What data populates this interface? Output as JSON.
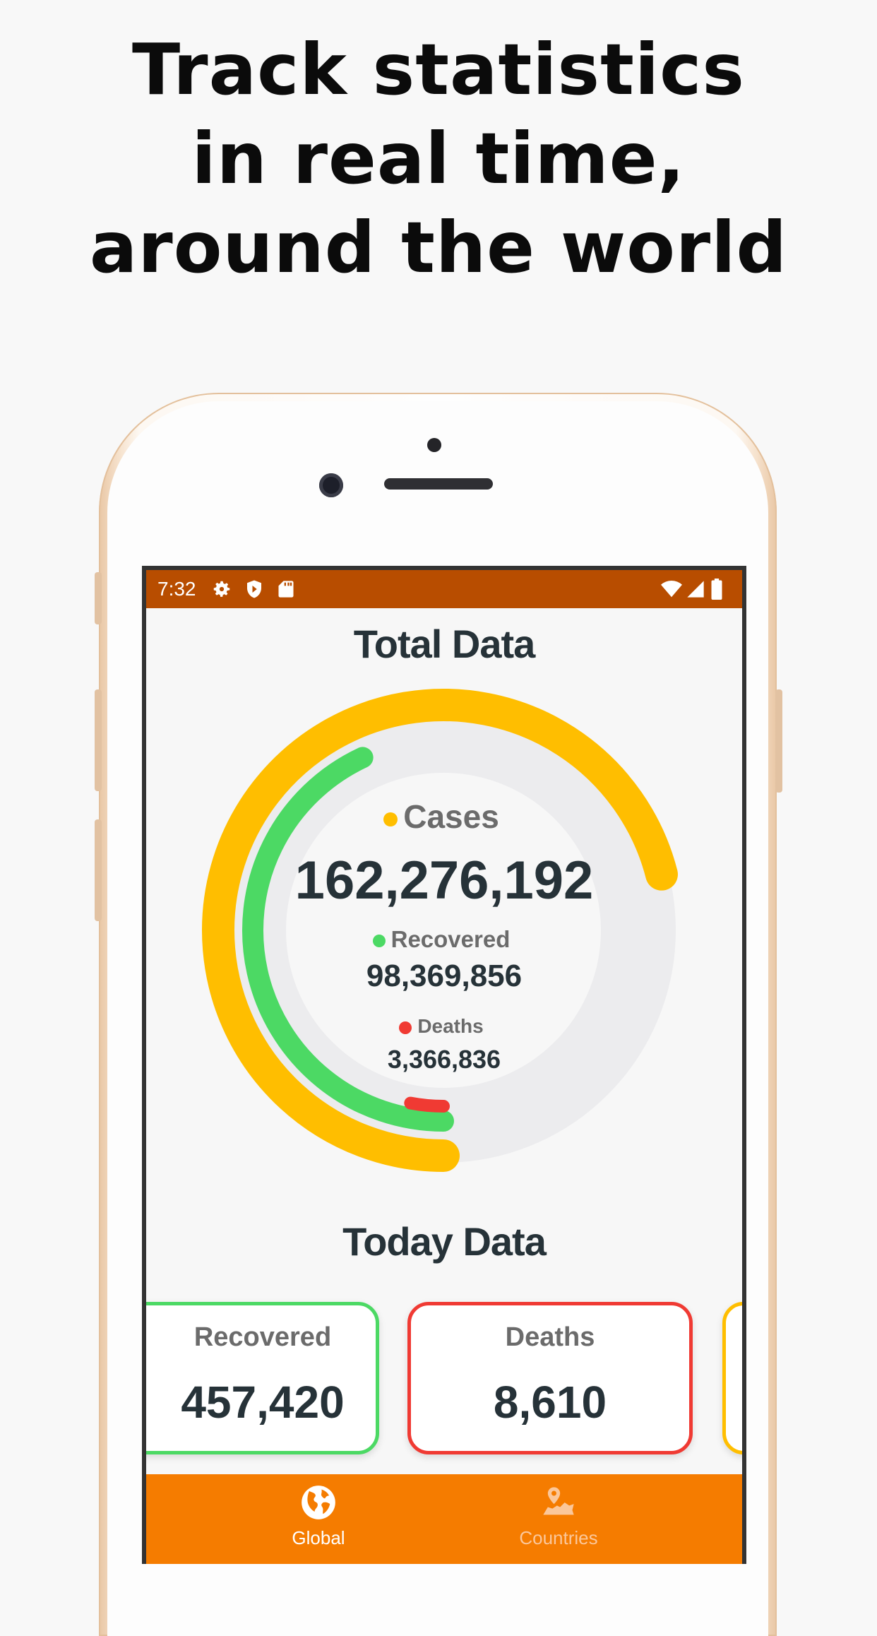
{
  "headline": {
    "line1": "Track statistics",
    "line2": "in real time,",
    "line3": "around the world"
  },
  "status_bar": {
    "time": "7:32",
    "icons": [
      "gear-icon",
      "shield-icon",
      "sd-card-icon",
      "wifi-icon",
      "signal-icon",
      "battery-icon"
    ]
  },
  "total": {
    "title": "Total Data",
    "cases_label": "Cases",
    "cases_value": "162,276,192",
    "recovered_label": "Recovered",
    "recovered_value": "98,369,856",
    "deaths_label": "Deaths",
    "deaths_value": "3,366,836"
  },
  "today": {
    "title": "Today Data",
    "cards": [
      {
        "label": "Recovered",
        "value": "457,420"
      },
      {
        "label": "Deaths",
        "value": "8,610"
      }
    ]
  },
  "nav": {
    "global_label": "Global",
    "countries_label": "Countries"
  },
  "colors": {
    "cases": "#ffbe00",
    "recovered": "#4cd964",
    "deaths": "#f03a33",
    "statusbar": "#b84d00",
    "nav": "#f57c00",
    "track": "#ececee"
  },
  "chart_data": {
    "type": "radial-bar",
    "categories": [
      "Cases",
      "Recovered",
      "Deaths"
    ],
    "values": [
      162276192,
      98369856,
      3366836
    ]
  }
}
